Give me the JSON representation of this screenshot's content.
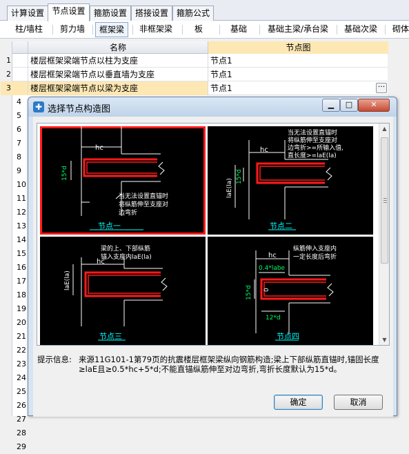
{
  "top_tabs": [
    "计算设置",
    "节点设置",
    "箍筋设置",
    "搭接设置",
    "箍筋公式"
  ],
  "active_top_tab": 1,
  "sub_tabs": [
    "柱/墙柱",
    "剪力墙",
    "框架梁",
    "非框架梁",
    "板",
    "基础",
    "基础主梁/承台梁",
    "基础次梁",
    "砌体"
  ],
  "active_sub_tab": 2,
  "grid": {
    "col_name": "名称",
    "col_node": "节点图",
    "rows": [
      {
        "num": "1",
        "name": "楼层框架梁端节点以柱为支座",
        "node": "节点1"
      },
      {
        "num": "2",
        "name": "楼层框架梁端节点以垂直墙为支座",
        "node": "节点1"
      },
      {
        "num": "3",
        "name": "楼层框架梁端节点以梁为支座",
        "node": "节点1"
      }
    ],
    "row_numbers": [
      "4",
      "5",
      "6",
      "7",
      "8",
      "9",
      "10",
      "11",
      "12",
      "13",
      "14",
      "15",
      "16",
      "17",
      "18",
      "19",
      "20",
      "21",
      "22",
      "23",
      "24",
      "25",
      "26",
      "27",
      "28",
      "29"
    ],
    "ellipsis": "···"
  },
  "dialog": {
    "title": "选择节点构造图",
    "min_glyph": "▁",
    "max_glyph": "□",
    "close_glyph": "✕",
    "icon_glyph": "✚",
    "nodes": [
      {
        "label": "节点一",
        "texts": [
          "hc",
          "15*d",
          "当无法设置直锚时",
          "将纵筋伸至支座对",
          "边弯折"
        ]
      },
      {
        "label": "节点二",
        "texts": [
          "当无法设置直锚时",
          "将纵筋伸至支座对",
          "边弯折>=所输入值,",
          "直长度>=laE(la)",
          "hc",
          "laE(la)",
          "15*d"
        ]
      },
      {
        "label": "节点三",
        "texts": [
          "梁的上、下部纵筋",
          "锚入支座内laE(la)",
          "hc",
          "laE(la)"
        ]
      },
      {
        "label": "节点四",
        "texts": [
          "hc",
          "纵筋伸入支座内",
          "一定长度后弯折",
          "0.4*labe",
          "15*d",
          "0",
          "12*d"
        ]
      }
    ],
    "selected_node": 0,
    "hint_label": "提示信息:",
    "hint_text": "来源11G101-1第79页的抗震楼层框架梁纵向钢筋构造;梁上下部纵筋直锚时,锚固长度≥laE且≥0.5*hc+5*d;不能直锚纵筋伸至对边弯折,弯折长度默认为15*d。",
    "ok_label": "确定",
    "cancel_label": "取消"
  },
  "colors": {
    "selection": "#fde8b4",
    "rebar": "#ff1a1a",
    "dimension": "#ffffff",
    "label": "#00ffff"
  }
}
